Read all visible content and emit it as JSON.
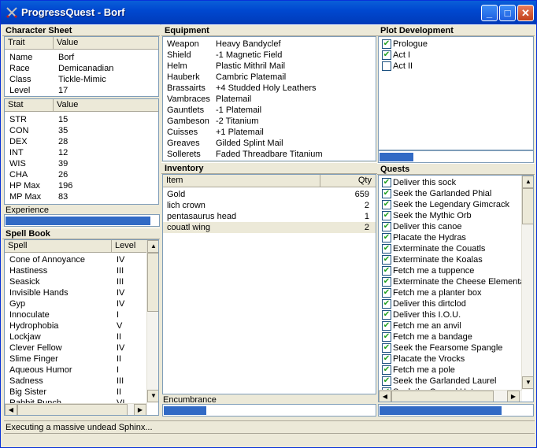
{
  "window": {
    "title": "ProgressQuest - Borf"
  },
  "character_sheet": {
    "title": "Character Sheet",
    "trait_headers": [
      "Trait",
      "Value"
    ],
    "traits": [
      {
        "name": "Name",
        "value": "Borf"
      },
      {
        "name": "Race",
        "value": "Demicanadian"
      },
      {
        "name": "Class",
        "value": "Tickle-Mimic"
      },
      {
        "name": "Level",
        "value": "17"
      }
    ],
    "stat_headers": [
      "Stat",
      "Value"
    ],
    "stats": [
      {
        "name": "STR",
        "value": "15"
      },
      {
        "name": "CON",
        "value": "35"
      },
      {
        "name": "DEX",
        "value": "28"
      },
      {
        "name": "INT",
        "value": "12"
      },
      {
        "name": "WIS",
        "value": "39"
      },
      {
        "name": "CHA",
        "value": "26"
      },
      {
        "name": "HP Max",
        "value": "196"
      },
      {
        "name": "MP Max",
        "value": "83"
      }
    ],
    "experience_label": "Experience",
    "experience_progress": 0.95
  },
  "spell_book": {
    "title": "Spell Book",
    "headers": [
      "Spell",
      "Level"
    ],
    "spells": [
      {
        "name": "Cone of Annoyance",
        "level": "IV"
      },
      {
        "name": "Hastiness",
        "level": "III"
      },
      {
        "name": "Seasick",
        "level": "III"
      },
      {
        "name": "Invisible Hands",
        "level": "IV"
      },
      {
        "name": "Gyp",
        "level": "IV"
      },
      {
        "name": "Innoculate",
        "level": "I"
      },
      {
        "name": "Hydrophobia",
        "level": "V"
      },
      {
        "name": "Lockjaw",
        "level": "II"
      },
      {
        "name": "Clever Fellow",
        "level": "IV"
      },
      {
        "name": "Slime Finger",
        "level": "II"
      },
      {
        "name": "Aqueous Humor",
        "level": "I"
      },
      {
        "name": "Sadness",
        "level": "III"
      },
      {
        "name": "Big Sister",
        "level": "II"
      },
      {
        "name": "Rabbit Punch",
        "level": "VI"
      }
    ]
  },
  "equipment": {
    "title": "Equipment",
    "items": [
      {
        "slot": "Weapon",
        "item": "Heavy Bandyclef"
      },
      {
        "slot": "Shield",
        "item": "-1 Magnetic Field"
      },
      {
        "slot": "Helm",
        "item": "Plastic Mithril Mail"
      },
      {
        "slot": "Hauberk",
        "item": "Cambric Platemail"
      },
      {
        "slot": "Brassairts",
        "item": "+4 Studded Holy Leathers"
      },
      {
        "slot": "Vambraces",
        "item": "Platemail"
      },
      {
        "slot": "Gauntlets",
        "item": "-1 Platemail"
      },
      {
        "slot": "Gambeson",
        "item": "-2 Titanium"
      },
      {
        "slot": "Cuisses",
        "item": "+1 Platemail"
      },
      {
        "slot": "Greaves",
        "item": "Gilded Splint Mail"
      },
      {
        "slot": "Sollerets",
        "item": "Faded Threadbare Titanium"
      }
    ]
  },
  "inventory": {
    "title": "Inventory",
    "headers": [
      "Item",
      "Qty"
    ],
    "items": [
      {
        "name": "Gold",
        "qty": "659"
      },
      {
        "name": "lich crown",
        "qty": "2"
      },
      {
        "name": "pentasaurus head",
        "qty": "1"
      },
      {
        "name": "couatl wing",
        "qty": "2"
      }
    ],
    "encumbrance_label": "Encumbrance",
    "encumbrance_progress": 0.2
  },
  "plot": {
    "title": "Plot Development",
    "acts": [
      {
        "label": "Prologue",
        "checked": true
      },
      {
        "label": "Act I",
        "checked": true
      },
      {
        "label": "Act II",
        "checked": false
      }
    ],
    "progress": 0.22
  },
  "quests": {
    "title": "Quests",
    "items": [
      {
        "label": "Deliver this sock",
        "checked": true
      },
      {
        "label": "Seek the Garlanded Phial",
        "checked": true
      },
      {
        "label": "Seek the Legendary Gimcrack",
        "checked": true
      },
      {
        "label": "Seek the Mythic Orb",
        "checked": true
      },
      {
        "label": "Deliver this canoe",
        "checked": true
      },
      {
        "label": "Placate the Hydras",
        "checked": true
      },
      {
        "label": "Exterminate the Couatls",
        "checked": true
      },
      {
        "label": "Exterminate the Koalas",
        "checked": true
      },
      {
        "label": "Fetch me a tuppence",
        "checked": true
      },
      {
        "label": "Exterminate the Cheese Elementals",
        "checked": true
      },
      {
        "label": "Fetch me a planter box",
        "checked": true
      },
      {
        "label": "Deliver this dirtclod",
        "checked": true
      },
      {
        "label": "Deliver this I.O.U.",
        "checked": true
      },
      {
        "label": "Fetch me an anvil",
        "checked": true
      },
      {
        "label": "Fetch me a bandage",
        "checked": true
      },
      {
        "label": "Seek the Fearsome Spangle",
        "checked": true
      },
      {
        "label": "Placate the Vrocks",
        "checked": true
      },
      {
        "label": "Fetch me a pole",
        "checked": true
      },
      {
        "label": "Seek the Garlanded Laurel",
        "checked": true
      },
      {
        "label": "Seek the Cursed Hat",
        "checked": true
      }
    ],
    "progress": 0.8
  },
  "status": {
    "text": "Executing a massive undead Sphinx..."
  }
}
